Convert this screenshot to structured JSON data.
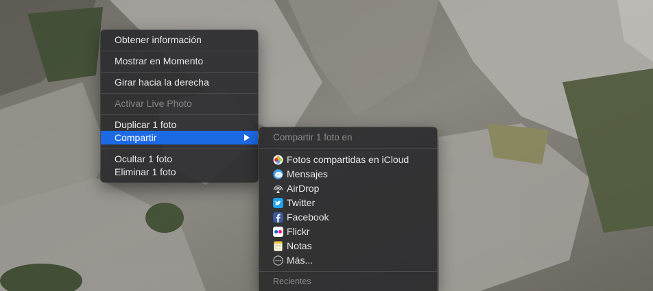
{
  "context_menu": {
    "items": [
      {
        "label": "Obtener información",
        "enabled": true
      },
      {
        "label": "Mostrar en Momento",
        "enabled": true
      },
      {
        "label": "Girar hacia la derecha",
        "enabled": true
      },
      {
        "label": "Activar Live Photo",
        "enabled": false
      },
      {
        "label": "Duplicar 1 foto",
        "enabled": true
      },
      {
        "label": "Compartir",
        "enabled": true,
        "selected": true,
        "submenu": true
      },
      {
        "label": "Ocultar 1 foto",
        "enabled": true
      },
      {
        "label": "Eliminar 1 foto",
        "enabled": true
      }
    ]
  },
  "share_submenu": {
    "header": "Compartir 1 foto en",
    "items": [
      {
        "label": "Fotos compartidas en iCloud",
        "icon": "icloud-photos-icon"
      },
      {
        "label": "Mensajes",
        "icon": "messages-icon"
      },
      {
        "label": "AirDrop",
        "icon": "airdrop-icon"
      },
      {
        "label": "Twitter",
        "icon": "twitter-icon"
      },
      {
        "label": "Facebook",
        "icon": "facebook-icon"
      },
      {
        "label": "Flickr",
        "icon": "flickr-icon"
      },
      {
        "label": "Notas",
        "icon": "notes-icon"
      },
      {
        "label": "Más...",
        "icon": "more-icon"
      }
    ],
    "recents_header": "Recientes"
  },
  "colors": {
    "menu_bg": "#2c2c2e",
    "selection": "#1d6ae5",
    "text": "#e8e8e8",
    "disabled_text": "#858585"
  }
}
